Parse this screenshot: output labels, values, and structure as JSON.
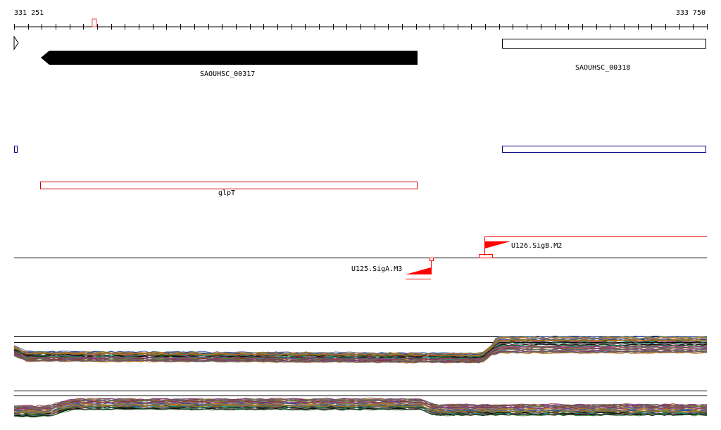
{
  "ruler": {
    "start_label": "331 251",
    "end_label": "333 750"
  },
  "features": {
    "genes": [
      {
        "name": "SAOUHSC_00317",
        "strand": "reverse",
        "style": "filled-arrow",
        "color": "#000000"
      },
      {
        "name": "SAOUHSC_00318",
        "strand": "forward",
        "style": "outline-box",
        "color": "#000000"
      }
    ],
    "gene_name": {
      "label": "glpT",
      "color": "#cc0000"
    },
    "blue_track_color": "#000080",
    "promoters": [
      {
        "label": "U125.SigA.M3",
        "strand": "reverse",
        "color": "#ff0000"
      },
      {
        "label": "U126.SigB.M2",
        "strand": "forward",
        "color": "#ff0000"
      }
    ]
  },
  "expression_tracks": {
    "track_count": 2,
    "series_colors": [
      "#000000",
      "#1f3f8f",
      "#8f1f1f",
      "#2f7f2f",
      "#9f7f1f",
      "#7f2f9f",
      "#1f8f8f",
      "#cf6f1f",
      "#5f5f5f",
      "#af2f5f",
      "#3f5faf",
      "#6f8f2f"
    ]
  }
}
